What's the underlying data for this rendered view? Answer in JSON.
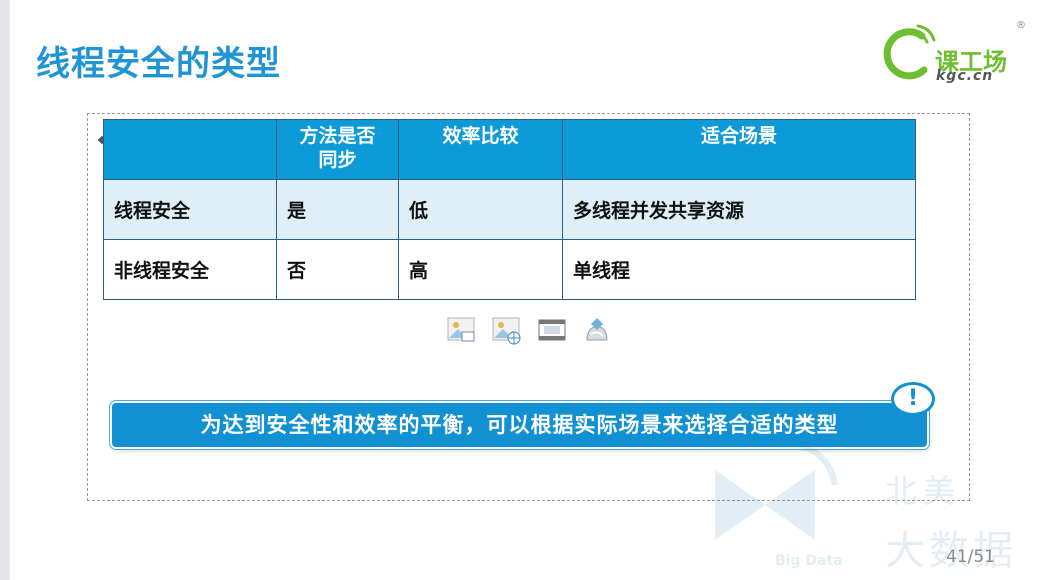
{
  "slide": {
    "title": "线程安全的类型",
    "page_number": "41/51"
  },
  "logo": {
    "cn": "课工场",
    "en": "kgc.cn",
    "reg": "®",
    "green": "#6dbf2f"
  },
  "table": {
    "headers": [
      "",
      "方法是否同步",
      "效率比较",
      "适合场景"
    ],
    "rows": [
      [
        "线程安全",
        "是",
        "低",
        "多线程并发共享资源"
      ],
      [
        "非线程安全",
        "否",
        "高",
        "单线程"
      ]
    ],
    "header_color": "#0d9ad8",
    "row1_color": "#deeff7",
    "border_color": "#2b5f86"
  },
  "placeholder_icons": [
    "picture-icon",
    "online-picture-icon",
    "video-icon",
    "smartart-icon"
  ],
  "note": {
    "text": "为达到安全性和效率的平衡，可以根据实际场景来选择合适的类型",
    "alert_symbol": "!",
    "color": "#1191d1"
  },
  "watermark": {
    "cn_line1": "北美",
    "cn_line2": "大数据",
    "en": "Big Data"
  }
}
